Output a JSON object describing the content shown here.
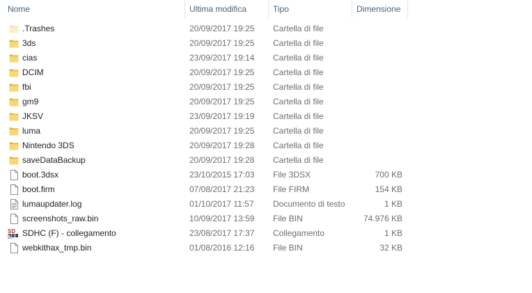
{
  "columns": {
    "name": "Nome",
    "modified": "Ultima modifica",
    "type": "Tipo",
    "size": "Dimensione"
  },
  "sort_indicator": "^",
  "files": [
    {
      "name": ".Trashes",
      "date": "20/09/2017 19:25",
      "type": "Cartella di file",
      "size": "",
      "icon": "folder-light-icon"
    },
    {
      "name": "3ds",
      "date": "20/09/2017 19:25",
      "type": "Cartella di file",
      "size": "",
      "icon": "folder-icon"
    },
    {
      "name": "cias",
      "date": "23/09/2017 19:14",
      "type": "Cartella di file",
      "size": "",
      "icon": "folder-icon"
    },
    {
      "name": "DCIM",
      "date": "20/09/2017 19:25",
      "type": "Cartella di file",
      "size": "",
      "icon": "folder-icon"
    },
    {
      "name": "fbi",
      "date": "20/09/2017 19:25",
      "type": "Cartella di file",
      "size": "",
      "icon": "folder-icon"
    },
    {
      "name": "gm9",
      "date": "20/09/2017 19:25",
      "type": "Cartella di file",
      "size": "",
      "icon": "folder-icon"
    },
    {
      "name": "JKSV",
      "date": "23/09/2017 19:19",
      "type": "Cartella di file",
      "size": "",
      "icon": "folder-icon"
    },
    {
      "name": "luma",
      "date": "20/09/2017 19:25",
      "type": "Cartella di file",
      "size": "",
      "icon": "folder-icon"
    },
    {
      "name": "Nintendo 3DS",
      "date": "20/09/2017 19:28",
      "type": "Cartella di file",
      "size": "",
      "icon": "folder-icon"
    },
    {
      "name": "saveDataBackup",
      "date": "20/09/2017 19:28",
      "type": "Cartella di file",
      "size": "",
      "icon": "folder-icon"
    },
    {
      "name": "boot.3dsx",
      "date": "23/10/2015 17:03",
      "type": "File 3DSX",
      "size": "700 KB",
      "icon": "file-icon"
    },
    {
      "name": "boot.firm",
      "date": "07/08/2017 21:23",
      "type": "File FIRM",
      "size": "154 KB",
      "icon": "file-icon"
    },
    {
      "name": "lumaupdater.log",
      "date": "01/10/2017 11:57",
      "type": "Documento di testo",
      "size": "1 KB",
      "icon": "text-file-icon"
    },
    {
      "name": "screenshots_raw.bin",
      "date": "10/09/2017 13:59",
      "type": "File BIN",
      "size": "74.976 KB",
      "icon": "file-icon"
    },
    {
      "name": "SDHC (F) - collegamento",
      "date": "23/08/2017 17:37",
      "type": "Collegamento",
      "size": "1 KB",
      "icon": "sd-card-shortcut-icon",
      "icon_text": "SD"
    },
    {
      "name": "webkithax_tmp.bin",
      "date": "01/08/2016 12:16",
      "type": "File BIN",
      "size": "32 KB",
      "icon": "file-icon"
    }
  ],
  "colors": {
    "header_text": "#4c607a",
    "folder": "#f8d775",
    "folder_dark": "#e0b03d",
    "secondary_text": "#6d6d6d"
  }
}
